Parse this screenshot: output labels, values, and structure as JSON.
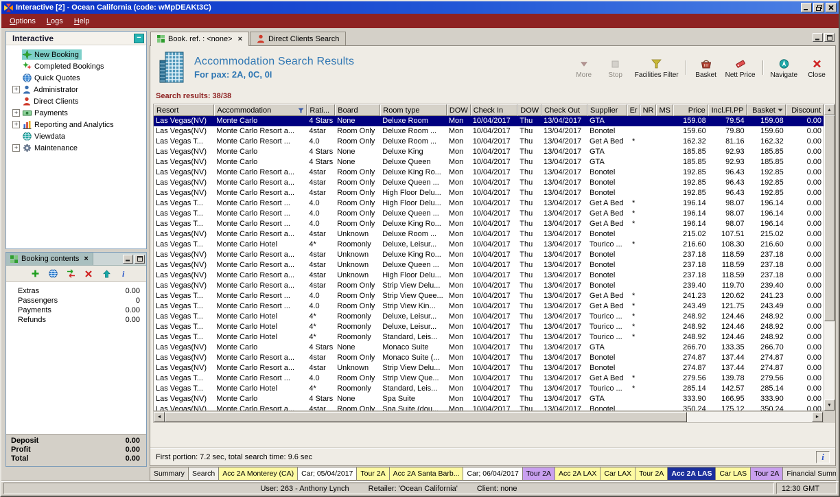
{
  "window": {
    "title": "Interactive [2] - Ocean California (code: wMpDEAKt3C)",
    "app_icon": "app-icon",
    "controls": [
      {
        "icon": "window-minimize-icon"
      },
      {
        "icon": "window-restore-icon"
      },
      {
        "icon": "window-close-icon"
      }
    ]
  },
  "menubar": {
    "items": [
      {
        "label": "Options"
      },
      {
        "label": "Logs"
      },
      {
        "label": "Help"
      }
    ]
  },
  "sidebar": {
    "title": "Interactive",
    "collapse_glyph": "−",
    "items": [
      {
        "label": "New Booking",
        "icon": "new-booking-icon",
        "selected": true,
        "expandable": false
      },
      {
        "label": "Completed Bookings",
        "icon": "completed-bookings-icon",
        "selected": false,
        "expandable": false
      },
      {
        "label": "Quick Quotes",
        "icon": "quick-quotes-icon",
        "selected": false,
        "expandable": false
      },
      {
        "label": "Administrator",
        "icon": "administrator-icon",
        "selected": false,
        "expandable": true
      },
      {
        "label": "Direct Clients",
        "icon": "direct-clients-icon",
        "selected": false,
        "expandable": false
      },
      {
        "label": "Payments",
        "icon": "payments-icon",
        "selected": false,
        "expandable": true
      },
      {
        "label": "Reporting and Analytics",
        "icon": "reporting-icon",
        "selected": false,
        "expandable": true
      },
      {
        "label": "Viewdata",
        "icon": "viewdata-icon",
        "selected": false,
        "expandable": false
      },
      {
        "label": "Maintenance",
        "icon": "maintenance-icon",
        "selected": false,
        "expandable": true
      }
    ]
  },
  "booking_contents": {
    "title": "Booking contents",
    "title_icon": "booking-contents-icon",
    "close_glyph": "×",
    "window_buttons": [
      {
        "icon": "panel-minimize-icon"
      },
      {
        "icon": "panel-restore-icon"
      }
    ],
    "toolbar": [
      {
        "icon": "add-icon"
      },
      {
        "icon": "world-icon"
      },
      {
        "icon": "transfer-icon"
      },
      {
        "icon": "delete-icon"
      },
      {
        "icon": "up-icon"
      },
      {
        "icon": "info-icon"
      }
    ],
    "rows": [
      {
        "label": "Extras",
        "value": "0.00"
      },
      {
        "label": "Passengers",
        "value": "0"
      },
      {
        "label": "Payments",
        "value": "0.00"
      },
      {
        "label": "Refunds",
        "value": "0.00"
      }
    ],
    "summary": [
      {
        "label": "Deposit",
        "value": "0.00"
      },
      {
        "label": "Profit",
        "value": "0.00"
      },
      {
        "label": "Total",
        "value": "0.00"
      }
    ]
  },
  "main": {
    "tabs": [
      {
        "label": "Book. ref. : <none>",
        "icon": "booking-tab-icon",
        "active": true,
        "closable": true,
        "close_glyph": "×"
      },
      {
        "label": "Direct Clients Search",
        "icon": "client-search-icon",
        "active": false,
        "closable": false
      }
    ],
    "panel_buttons": [
      {
        "icon": "panel-minimize-icon"
      },
      {
        "icon": "panel-restore-icon"
      }
    ],
    "header": {
      "icon": "hotel-building-icon",
      "title": "Accommodation Search Results",
      "subtitle": "For pax: 2A, 0C, 0I"
    },
    "toolbar": [
      {
        "label": "More",
        "icon": "more-icon",
        "enabled": false
      },
      {
        "label": "Stop",
        "icon": "stop-icon",
        "enabled": false
      },
      {
        "label": "Facilities Filter",
        "icon": "filter-icon",
        "enabled": true
      },
      {
        "separator": true
      },
      {
        "label": "Basket",
        "icon": "basket-icon",
        "enabled": true
      },
      {
        "label": "Nett Price",
        "icon": "nett-price-icon",
        "enabled": true
      },
      {
        "separator": true
      },
      {
        "label": "Navigate",
        "icon": "navigate-icon",
        "enabled": true
      },
      {
        "label": "Close",
        "icon": "close-red-icon",
        "enabled": true
      }
    ],
    "results_label": "Search results: 38/38",
    "table": {
      "columns": [
        {
          "label": "Resort"
        },
        {
          "label": "Accommodation",
          "icon": "column-filter-icon"
        },
        {
          "label": "Rati..."
        },
        {
          "label": "Board"
        },
        {
          "label": "Room type"
        },
        {
          "label": "DOW"
        },
        {
          "label": "Check In"
        },
        {
          "label": "DOW"
        },
        {
          "label": "Check Out"
        },
        {
          "label": "Supplier"
        },
        {
          "label": "Er"
        },
        {
          "label": "NR"
        },
        {
          "label": "MS"
        },
        {
          "label": "Price"
        },
        {
          "label": "Incl.Fl.PP"
        },
        {
          "label": "Basket",
          "icon": "column-sort-icon"
        },
        {
          "label": "Discount"
        }
      ],
      "selected_row": 0,
      "rows": [
        [
          "Las Vegas(NV)",
          "Monte Carlo",
          "4 Stars",
          "None",
          "Deluxe Room",
          "Mon",
          "10/04/2017",
          "Thu",
          "13/04/2017",
          "GTA",
          "",
          "",
          "",
          "159.08",
          "79.54",
          "159.08",
          "0.00"
        ],
        [
          "Las Vegas(NV)",
          "Monte Carlo Resort a...",
          "4star",
          "Room Only",
          "Deluxe Room ...",
          "Mon",
          "10/04/2017",
          "Thu",
          "13/04/2017",
          "Bonotel",
          "",
          "",
          "",
          "159.60",
          "79.80",
          "159.60",
          "0.00"
        ],
        [
          "Las Vegas T...",
          "Monte Carlo Resort ...",
          "4.0",
          "Room Only",
          "Deluxe Room ...",
          "Mon",
          "10/04/2017",
          "Thu",
          "13/04/2017",
          "Get A Bed",
          "*",
          "",
          "",
          "162.32",
          "81.16",
          "162.32",
          "0.00"
        ],
        [
          "Las Vegas(NV)",
          "Monte Carlo",
          "4 Stars",
          "None",
          "Deluxe King",
          "Mon",
          "10/04/2017",
          "Thu",
          "13/04/2017",
          "GTA",
          "",
          "",
          "",
          "185.85",
          "92.93",
          "185.85",
          "0.00"
        ],
        [
          "Las Vegas(NV)",
          "Monte Carlo",
          "4 Stars",
          "None",
          "Deluxe Queen",
          "Mon",
          "10/04/2017",
          "Thu",
          "13/04/2017",
          "GTA",
          "",
          "",
          "",
          "185.85",
          "92.93",
          "185.85",
          "0.00"
        ],
        [
          "Las Vegas(NV)",
          "Monte Carlo Resort a...",
          "4star",
          "Room Only",
          "Deluxe King Ro...",
          "Mon",
          "10/04/2017",
          "Thu",
          "13/04/2017",
          "Bonotel",
          "",
          "",
          "",
          "192.85",
          "96.43",
          "192.85",
          "0.00"
        ],
        [
          "Las Vegas(NV)",
          "Monte Carlo Resort a...",
          "4star",
          "Room Only",
          "Deluxe Queen ...",
          "Mon",
          "10/04/2017",
          "Thu",
          "13/04/2017",
          "Bonotel",
          "",
          "",
          "",
          "192.85",
          "96.43",
          "192.85",
          "0.00"
        ],
        [
          "Las Vegas(NV)",
          "Monte Carlo Resort a...",
          "4star",
          "Room Only",
          "High Floor Delu...",
          "Mon",
          "10/04/2017",
          "Thu",
          "13/04/2017",
          "Bonotel",
          "",
          "",
          "",
          "192.85",
          "96.43",
          "192.85",
          "0.00"
        ],
        [
          "Las Vegas T...",
          "Monte Carlo Resort ...",
          "4.0",
          "Room Only",
          "High Floor Delu...",
          "Mon",
          "10/04/2017",
          "Thu",
          "13/04/2017",
          "Get A Bed",
          "*",
          "",
          "",
          "196.14",
          "98.07",
          "196.14",
          "0.00"
        ],
        [
          "Las Vegas T...",
          "Monte Carlo Resort ...",
          "4.0",
          "Room Only",
          "Deluxe Queen ...",
          "Mon",
          "10/04/2017",
          "Thu",
          "13/04/2017",
          "Get A Bed",
          "*",
          "",
          "",
          "196.14",
          "98.07",
          "196.14",
          "0.00"
        ],
        [
          "Las Vegas T...",
          "Monte Carlo Resort ...",
          "4.0",
          "Room Only",
          "Deluxe King Ro...",
          "Mon",
          "10/04/2017",
          "Thu",
          "13/04/2017",
          "Get A Bed",
          "*",
          "",
          "",
          "196.14",
          "98.07",
          "196.14",
          "0.00"
        ],
        [
          "Las Vegas(NV)",
          "Monte Carlo Resort a...",
          "4star",
          "Unknown",
          "Deluxe Room ...",
          "Mon",
          "10/04/2017",
          "Thu",
          "13/04/2017",
          "Bonotel",
          "",
          "",
          "",
          "215.02",
          "107.51",
          "215.02",
          "0.00"
        ],
        [
          "Las Vegas T...",
          "Monte Carlo Hotel",
          "4*",
          "Roomonly",
          "Deluxe, Leisur...",
          "Mon",
          "10/04/2017",
          "Thu",
          "13/04/2017",
          "Tourico ...",
          "*",
          "",
          "",
          "216.60",
          "108.30",
          "216.60",
          "0.00"
        ],
        [
          "Las Vegas(NV)",
          "Monte Carlo Resort a...",
          "4star",
          "Unknown",
          "Deluxe King Ro...",
          "Mon",
          "10/04/2017",
          "Thu",
          "13/04/2017",
          "Bonotel",
          "",
          "",
          "",
          "237.18",
          "118.59",
          "237.18",
          "0.00"
        ],
        [
          "Las Vegas(NV)",
          "Monte Carlo Resort a...",
          "4star",
          "Unknown",
          "Deluxe Queen ...",
          "Mon",
          "10/04/2017",
          "Thu",
          "13/04/2017",
          "Bonotel",
          "",
          "",
          "",
          "237.18",
          "118.59",
          "237.18",
          "0.00"
        ],
        [
          "Las Vegas(NV)",
          "Monte Carlo Resort a...",
          "4star",
          "Unknown",
          "High Floor Delu...",
          "Mon",
          "10/04/2017",
          "Thu",
          "13/04/2017",
          "Bonotel",
          "",
          "",
          "",
          "237.18",
          "118.59",
          "237.18",
          "0.00"
        ],
        [
          "Las Vegas(NV)",
          "Monte Carlo Resort a...",
          "4star",
          "Room Only",
          "Strip View Delu...",
          "Mon",
          "10/04/2017",
          "Thu",
          "13/04/2017",
          "Bonotel",
          "",
          "",
          "",
          "239.40",
          "119.70",
          "239.40",
          "0.00"
        ],
        [
          "Las Vegas T...",
          "Monte Carlo Resort ...",
          "4.0",
          "Room Only",
          "Strip View Quee...",
          "Mon",
          "10/04/2017",
          "Thu",
          "13/04/2017",
          "Get A Bed",
          "*",
          "",
          "",
          "241.23",
          "120.62",
          "241.23",
          "0.00"
        ],
        [
          "Las Vegas T...",
          "Monte Carlo Resort ...",
          "4.0",
          "Room Only",
          "Strip View Kin...",
          "Mon",
          "10/04/2017",
          "Thu",
          "13/04/2017",
          "Get A Bed",
          "*",
          "",
          "",
          "243.49",
          "121.75",
          "243.49",
          "0.00"
        ],
        [
          "Las Vegas T...",
          "Monte Carlo Hotel",
          "4*",
          "Roomonly",
          "Deluxe, Leisur...",
          "Mon",
          "10/04/2017",
          "Thu",
          "13/04/2017",
          "Tourico ...",
          "*",
          "",
          "",
          "248.92",
          "124.46",
          "248.92",
          "0.00"
        ],
        [
          "Las Vegas T...",
          "Monte Carlo Hotel",
          "4*",
          "Roomonly",
          "Deluxe, Leisur...",
          "Mon",
          "10/04/2017",
          "Thu",
          "13/04/2017",
          "Tourico ...",
          "*",
          "",
          "",
          "248.92",
          "124.46",
          "248.92",
          "0.00"
        ],
        [
          "Las Vegas T...",
          "Monte Carlo Hotel",
          "4*",
          "Roomonly",
          "Standard, Leis...",
          "Mon",
          "10/04/2017",
          "Thu",
          "13/04/2017",
          "Tourico ...",
          "*",
          "",
          "",
          "248.92",
          "124.46",
          "248.92",
          "0.00"
        ],
        [
          "Las Vegas(NV)",
          "Monte Carlo",
          "4 Stars",
          "None",
          "Monaco Suite",
          "Mon",
          "10/04/2017",
          "Thu",
          "13/04/2017",
          "GTA",
          "",
          "",
          "",
          "266.70",
          "133.35",
          "266.70",
          "0.00"
        ],
        [
          "Las Vegas(NV)",
          "Monte Carlo Resort a...",
          "4star",
          "Room Only",
          "Monaco Suite (...",
          "Mon",
          "10/04/2017",
          "Thu",
          "13/04/2017",
          "Bonotel",
          "",
          "",
          "",
          "274.87",
          "137.44",
          "274.87",
          "0.00"
        ],
        [
          "Las Vegas(NV)",
          "Monte Carlo Resort a...",
          "4star",
          "Unknown",
          "Strip View Delu...",
          "Mon",
          "10/04/2017",
          "Thu",
          "13/04/2017",
          "Bonotel",
          "",
          "",
          "",
          "274.87",
          "137.44",
          "274.87",
          "0.00"
        ],
        [
          "Las Vegas T...",
          "Monte Carlo Resort ...",
          "4.0",
          "Room Only",
          "Strip View Que...",
          "Mon",
          "10/04/2017",
          "Thu",
          "13/04/2017",
          "Get A Bed",
          "*",
          "",
          "",
          "279.56",
          "139.78",
          "279.56",
          "0.00"
        ],
        [
          "Las Vegas T...",
          "Monte Carlo Hotel",
          "4*",
          "Roomonly",
          "Standard, Leis...",
          "Mon",
          "10/04/2017",
          "Thu",
          "13/04/2017",
          "Tourico ...",
          "*",
          "",
          "",
          "285.14",
          "142.57",
          "285.14",
          "0.00"
        ],
        [
          "Las Vegas(NV)",
          "Monte Carlo",
          "4 Stars",
          "None",
          "Spa Suite",
          "Mon",
          "10/04/2017",
          "Thu",
          "13/04/2017",
          "GTA",
          "",
          "",
          "",
          "333.90",
          "166.95",
          "333.90",
          "0.00"
        ],
        [
          "Las Vegas(NV)",
          "Monte Carlo Resort a...",
          "4star",
          "Room Only",
          "Spa Suite (dou...",
          "Mon",
          "10/04/2017",
          "Thu",
          "13/04/2017",
          "Bonotel",
          "",
          "",
          "",
          "350.24",
          "175.12",
          "350.24",
          "0.00"
        ]
      ]
    },
    "footer_status": "First portion: 7.2 sec, total search time: 9.6 sec",
    "footer_info_glyph": "i",
    "bottom_tabs": [
      {
        "label": "Summary",
        "bg": "#e4e0d8",
        "fg": "#000000"
      },
      {
        "label": "Search",
        "bg": "#f2f0ec",
        "fg": "#000000"
      },
      {
        "label": "Acc 2A Monterey (CA)",
        "bg": "#fdfaa2",
        "fg": "#000000"
      },
      {
        "label": "Car; 05/04/2017",
        "bg": "#fdfdfb",
        "fg": "#000000"
      },
      {
        "label": "Tour 2A",
        "bg": "#fdfaa2",
        "fg": "#000000"
      },
      {
        "label": "Acc 2A Santa Barb...",
        "bg": "#fdfaa2",
        "fg": "#000000"
      },
      {
        "label": "Car; 06/04/2017",
        "bg": "#fdfdfb",
        "fg": "#000000"
      },
      {
        "label": "Tour 2A",
        "bg": "#c9a0ef",
        "fg": "#000000"
      },
      {
        "label": "Acc 2A LAX",
        "bg": "#fdfaa2",
        "fg": "#000000"
      },
      {
        "label": "Car LAX",
        "bg": "#fdfaa2",
        "fg": "#000000"
      },
      {
        "label": "Tour 2A",
        "bg": "#fdfaa2",
        "fg": "#000000"
      },
      {
        "label": "Acc 2A LAS",
        "bg": "#1c2f9c",
        "fg": "#ffffff",
        "selected": true
      },
      {
        "label": "Car LAS",
        "bg": "#fdfaa2",
        "fg": "#000000"
      },
      {
        "label": "Tour 2A",
        "bg": "#c9a0ef",
        "fg": "#000000"
      },
      {
        "label": "Financial Summary",
        "bg": "#e4e0d8",
        "fg": "#000000"
      }
    ]
  },
  "scrollbars": {
    "up": "▲",
    "down": "▼",
    "left": "◄",
    "right": "►"
  },
  "statusbar": {
    "user": "User: 263 - Anthony Lynch",
    "retailer": "Retailer: 'Ocean California'",
    "client": "Client: none",
    "time": "12:30 GMT"
  },
  "colors": {
    "titlebar_blue": "#1048d0",
    "menubar_maroon": "#8e2222",
    "row_selection": "#000080",
    "tree_selection": "#7ed0ca",
    "results_label_maroon": "#8e2323",
    "header_title_blue": "#3077b3",
    "tab_yellow": "#fdfaa2",
    "tab_purple": "#c9a0ef",
    "tab_selected_navy": "#1c2f9c"
  }
}
